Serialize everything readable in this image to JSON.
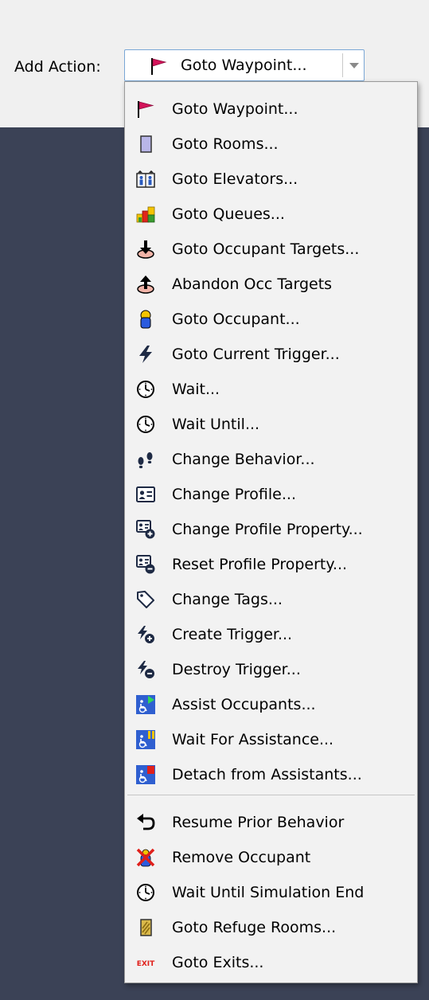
{
  "add_action": {
    "label": "Add Action:",
    "selected": "Goto Waypoint..."
  },
  "menu": {
    "group1": [
      {
        "label": "Goto Waypoint...",
        "icon": "flag-icon"
      },
      {
        "label": "Goto Rooms...",
        "icon": "room-icon"
      },
      {
        "label": "Goto Elevators...",
        "icon": "elevator-icon"
      },
      {
        "label": "Goto Queues...",
        "icon": "queue-icon"
      },
      {
        "label": "Goto Occupant Targets...",
        "icon": "target-down-icon"
      },
      {
        "label": "Abandon Occ Targets",
        "icon": "target-up-icon"
      },
      {
        "label": "Goto Occupant...",
        "icon": "occupant-icon"
      },
      {
        "label": "Goto Current Trigger...",
        "icon": "lightning-icon"
      },
      {
        "label": "Wait...",
        "icon": "clock-icon"
      },
      {
        "label": "Wait Until...",
        "icon": "clock-icon"
      },
      {
        "label": "Change Behavior...",
        "icon": "footprints-icon"
      },
      {
        "label": "Change Profile...",
        "icon": "profile-card-icon"
      },
      {
        "label": "Change Profile Property...",
        "icon": "profile-add-icon"
      },
      {
        "label": "Reset Profile Property...",
        "icon": "profile-remove-icon"
      },
      {
        "label": "Change Tags...",
        "icon": "tag-icon"
      },
      {
        "label": "Create Trigger...",
        "icon": "trigger-add-icon"
      },
      {
        "label": "Destroy Trigger...",
        "icon": "trigger-remove-icon"
      },
      {
        "label": "Assist Occupants...",
        "icon": "assist-play-icon"
      },
      {
        "label": "Wait For Assistance...",
        "icon": "assist-pause-icon"
      },
      {
        "label": "Detach from Assistants...",
        "icon": "assist-stop-icon"
      }
    ],
    "group2": [
      {
        "label": "Resume Prior Behavior",
        "icon": "resume-arrow-icon"
      },
      {
        "label": "Remove Occupant",
        "icon": "remove-occupant-icon"
      },
      {
        "label": "Wait Until Simulation End",
        "icon": "clock-icon"
      },
      {
        "label": "Goto Refuge Rooms...",
        "icon": "refuge-room-icon"
      },
      {
        "label": "Goto Exits...",
        "icon": "exit-sign-icon",
        "icon_text": "EXIT"
      }
    ]
  }
}
